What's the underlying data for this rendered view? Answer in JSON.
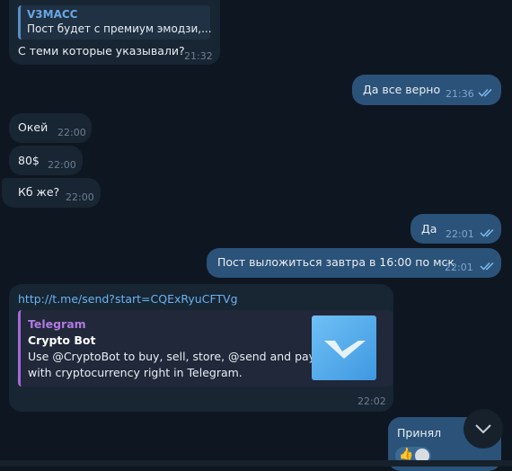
{
  "messages": {
    "m1": {
      "reply_name": "V3MACC",
      "reply_text": "Пост будет с премиум эмодзи,...",
      "text": "С теми которые указывали?",
      "time": "21:32"
    },
    "m2": {
      "text": "Да все верно",
      "time": "21:36"
    },
    "m3": {
      "text": "Окей",
      "time": "22:00"
    },
    "m4": {
      "text": "80$",
      "time": "22:00"
    },
    "m5": {
      "text": "Кб же?",
      "time": "22:00"
    },
    "m6": {
      "text": "Да",
      "time": "22:01"
    },
    "m7": {
      "text": "Пост выложиться завтра в 16:00 по мск",
      "time": "22:01"
    },
    "m8": {
      "link": "http://t.me/send?start=CQExRyuCFTVg",
      "site": "Telegram",
      "title": "Crypto Bot",
      "desc_line1": "Use @CryptoBot to buy, sell, store, @send and pay",
      "desc_line2": "with cryptocurrency right in Telegram.",
      "time": "22:02"
    },
    "m9": {
      "text": "Принял"
    }
  },
  "icons": {
    "read_checks": "double-check-icon",
    "scroll_down": "chevron-down-icon"
  },
  "colors": {
    "background": "#0e1621",
    "incoming": "#182533",
    "outgoing": "#2b5278",
    "link": "#6ab3f3",
    "preview_accent": "#a56ad6"
  }
}
